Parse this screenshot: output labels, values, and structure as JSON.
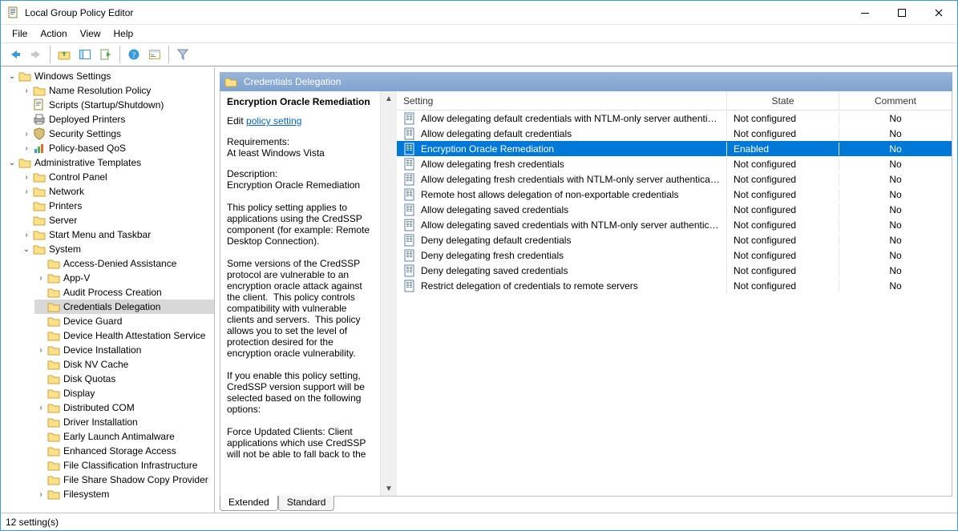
{
  "window": {
    "title": "Local Group Policy Editor"
  },
  "menu": {
    "file": "File",
    "action": "Action",
    "view": "View",
    "help": "Help"
  },
  "toolbar_icons": [
    "back-icon",
    "forward-icon",
    "up-folder-icon",
    "options-icon",
    "export-icon",
    "help-icon",
    "properties-icon",
    "filter-icon"
  ],
  "tree": {
    "windows_settings": "Windows Settings",
    "name_resolution_policy": "Name Resolution Policy",
    "scripts": "Scripts (Startup/Shutdown)",
    "deployed_printers": "Deployed Printers",
    "security_settings": "Security Settings",
    "policy_based_qos": "Policy-based QoS",
    "administrative_templates": "Administrative Templates",
    "control_panel": "Control Panel",
    "network": "Network",
    "printers": "Printers",
    "server": "Server",
    "start_menu": "Start Menu and Taskbar",
    "system": "System",
    "system_children": [
      "Access-Denied Assistance",
      "App-V",
      "Audit Process Creation",
      "Credentials Delegation",
      "Device Guard",
      "Device Health Attestation Service",
      "Device Installation",
      "Disk NV Cache",
      "Disk Quotas",
      "Display",
      "Distributed COM",
      "Driver Installation",
      "Early Launch Antimalware",
      "Enhanced Storage Access",
      "File Classification Infrastructure",
      "File Share Shadow Copy Provider",
      "Filesystem"
    ],
    "system_child_expandable": [
      false,
      true,
      false,
      false,
      false,
      false,
      true,
      false,
      false,
      false,
      true,
      false,
      false,
      false,
      false,
      false,
      true
    ],
    "selected": "Credentials Delegation"
  },
  "content": {
    "header": "Credentials Delegation",
    "setting_title": "Encryption Oracle Remediation",
    "edit_label": "Edit",
    "edit_link": "policy setting",
    "requirements_label": "Requirements:",
    "requirements_value": "At least Windows Vista",
    "description_label": "Description:",
    "description_text": "Encryption Oracle Remediation\n\nThis policy setting applies to applications using the CredSSP component (for example: Remote Desktop Connection).\n\nSome versions of the CredSSP protocol are vulnerable to an encryption oracle attack against the client.  This policy controls compatibility with vulnerable clients and servers.  This policy allows you to set the level of protection desired for the encryption oracle vulnerability.\n\nIf you enable this policy setting, CredSSP version support will be selected based on the following options:\n\nForce Updated Clients: Client applications which use CredSSP will not be able to fall back to the"
  },
  "columns": {
    "setting": "Setting",
    "state": "State",
    "comment": "Comment"
  },
  "settings": [
    {
      "name": "Allow delegating default credentials with NTLM-only server authentication",
      "state": "Not configured",
      "comment": "No"
    },
    {
      "name": "Allow delegating default credentials",
      "state": "Not configured",
      "comment": "No"
    },
    {
      "name": "Encryption Oracle Remediation",
      "state": "Enabled",
      "comment": "No",
      "selected": true
    },
    {
      "name": "Allow delegating fresh credentials",
      "state": "Not configured",
      "comment": "No"
    },
    {
      "name": "Allow delegating fresh credentials with NTLM-only server authentication",
      "state": "Not configured",
      "comment": "No"
    },
    {
      "name": "Remote host allows delegation of non-exportable credentials",
      "state": "Not configured",
      "comment": "No"
    },
    {
      "name": "Allow delegating saved credentials",
      "state": "Not configured",
      "comment": "No"
    },
    {
      "name": "Allow delegating saved credentials with NTLM-only server authentication",
      "state": "Not configured",
      "comment": "No"
    },
    {
      "name": "Deny delegating default credentials",
      "state": "Not configured",
      "comment": "No"
    },
    {
      "name": "Deny delegating fresh credentials",
      "state": "Not configured",
      "comment": "No"
    },
    {
      "name": "Deny delegating saved credentials",
      "state": "Not configured",
      "comment": "No"
    },
    {
      "name": "Restrict delegation of credentials to remote servers",
      "state": "Not configured",
      "comment": "No"
    }
  ],
  "tabs": {
    "extended": "Extended",
    "standard": "Standard"
  },
  "status": "12 setting(s)"
}
